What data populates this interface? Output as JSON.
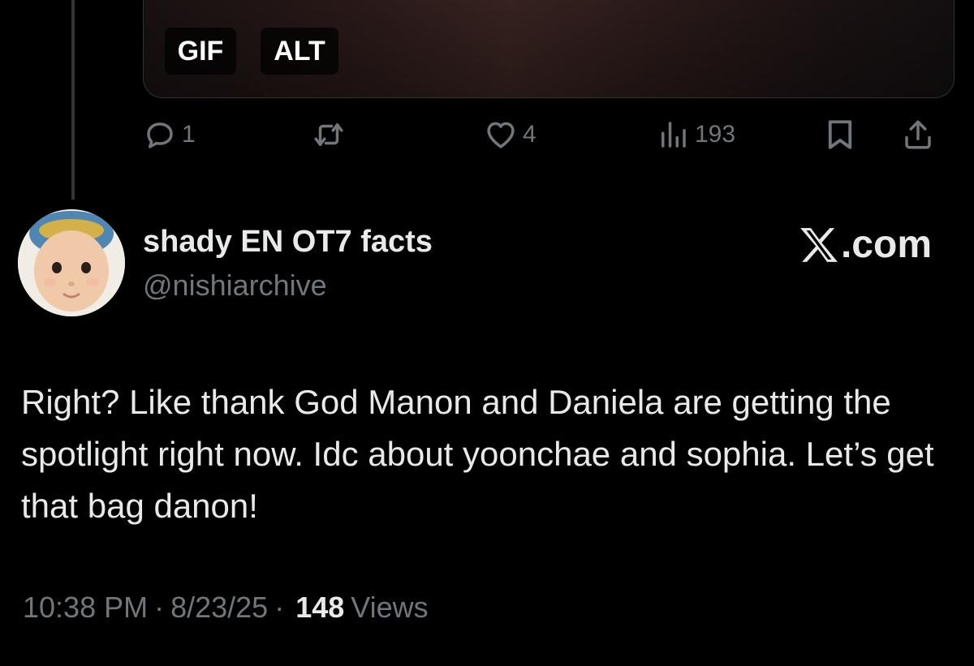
{
  "media": {
    "gif_label": "GIF",
    "alt_label": "ALT"
  },
  "actions": {
    "reply_count": "1",
    "retweet_count": "",
    "like_count": "4",
    "views_count": "193"
  },
  "author": {
    "name": "shady EN OT7 facts",
    "handle": "@nishiarchive"
  },
  "brand": {
    "label": ".com",
    "icon": "x-logo-icon"
  },
  "tweet": {
    "text": "Right? Like thank God Manon and Daniela are getting the spotlight right now. Idc about yoonchae and sophia. Let’s get that bag danon!"
  },
  "meta": {
    "time": "10:38 PM",
    "date": "8/23/25",
    "views_num": "148",
    "views_label": "Views",
    "separator": "·"
  },
  "colors": {
    "background": "#000000",
    "text": "#e7e9ea",
    "muted": "#71767b"
  }
}
